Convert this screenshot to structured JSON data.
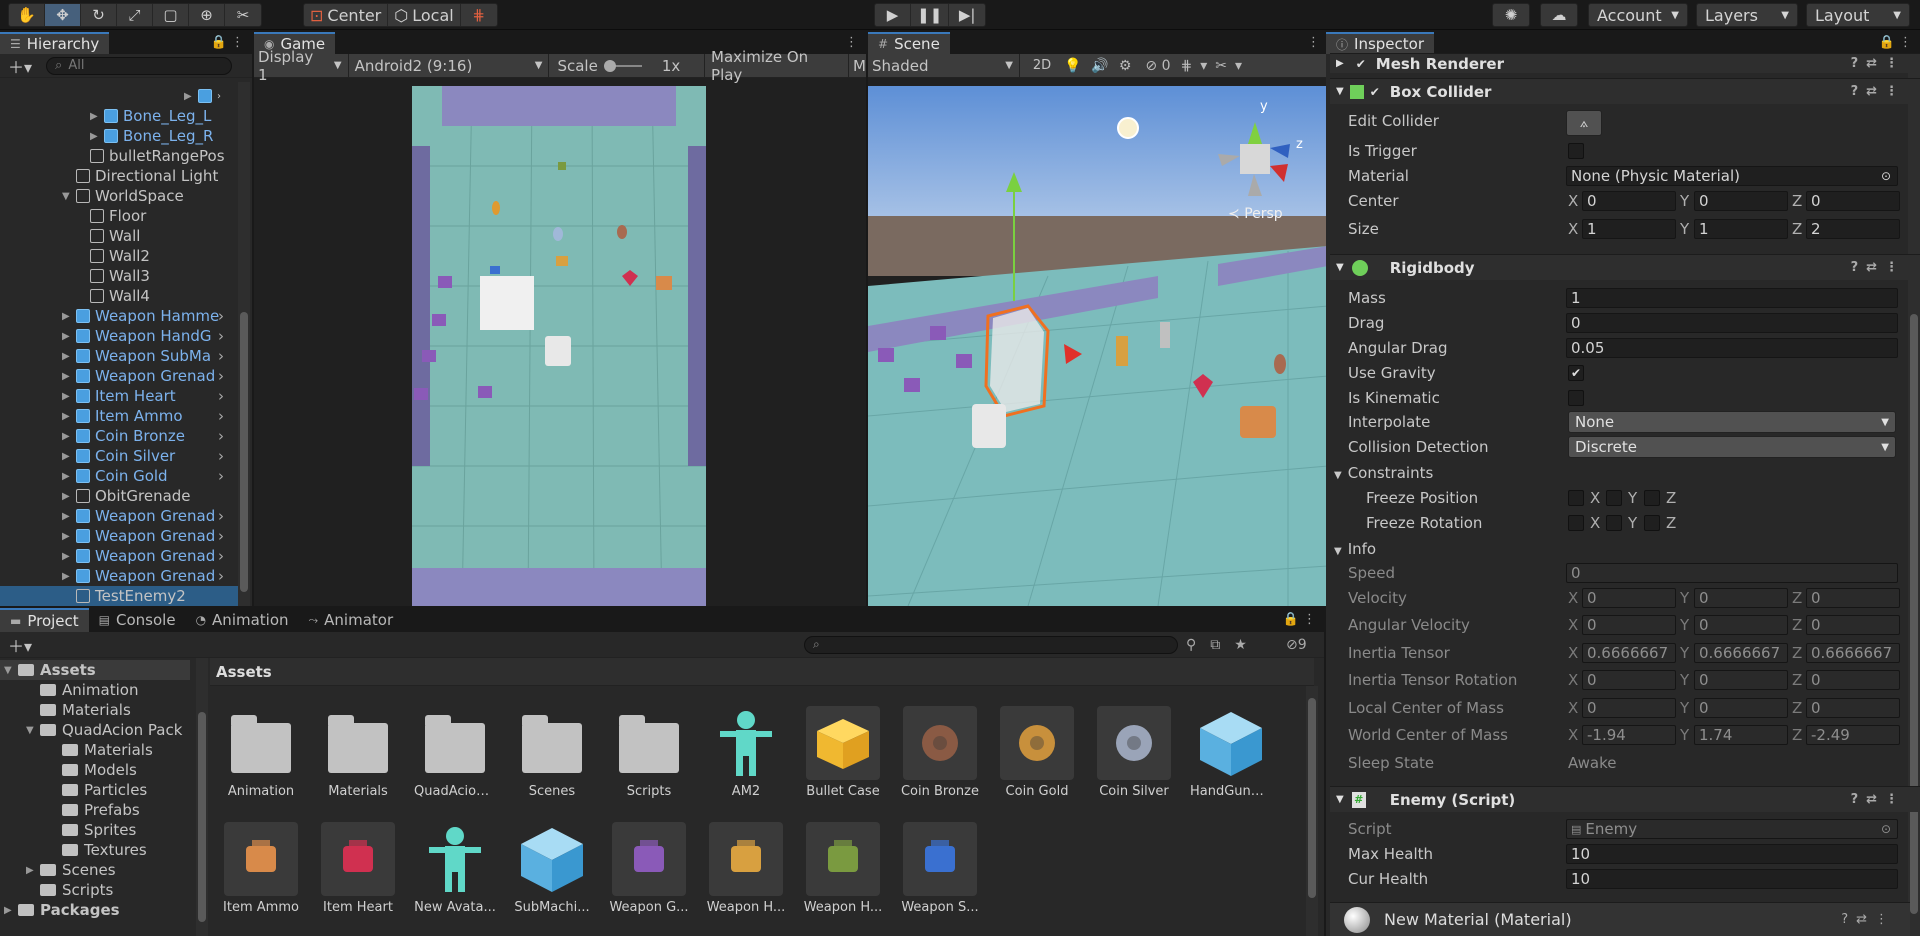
{
  "toolbar": {
    "pivot_center": "Center",
    "pivot_local": "Local",
    "account": "Account",
    "layers": "Layers",
    "layout": "Layout"
  },
  "hierarchy": {
    "tab": "Hierarchy",
    "search_placeholder": "All",
    "items": [
      {
        "label": "Bone_Leg_L",
        "depth": 6,
        "prefab": true,
        "expandable": true
      },
      {
        "label": "Bone_Leg_R",
        "depth": 6,
        "prefab": true,
        "expandable": true
      },
      {
        "label": "bulletRangePos",
        "depth": 5,
        "prefab": false,
        "expandable": false
      },
      {
        "label": "Directional Light",
        "depth": 4,
        "prefab": false,
        "expandable": false
      },
      {
        "label": "WorldSpace",
        "depth": 4,
        "prefab": false,
        "expandable": true
      },
      {
        "label": "Floor",
        "depth": 5,
        "prefab": false,
        "expandable": false
      },
      {
        "label": "Wall",
        "depth": 5,
        "prefab": false,
        "expandable": false
      },
      {
        "label": "Wall2",
        "depth": 5,
        "prefab": false,
        "expandable": false
      },
      {
        "label": "Wall3",
        "depth": 5,
        "prefab": false,
        "expandable": false
      },
      {
        "label": "Wall4",
        "depth": 5,
        "prefab": false,
        "expandable": false
      },
      {
        "label": "Weapon Hamme",
        "depth": 4,
        "prefab": true,
        "expandable": true
      },
      {
        "label": "Weapon HandG",
        "depth": 4,
        "prefab": true,
        "expandable": true
      },
      {
        "label": "Weapon SubMa",
        "depth": 4,
        "prefab": true,
        "expandable": true
      },
      {
        "label": "Weapon Grenad",
        "depth": 4,
        "prefab": true,
        "expandable": true
      },
      {
        "label": "Item Heart",
        "depth": 4,
        "prefab": true,
        "expandable": true
      },
      {
        "label": "Item Ammo",
        "depth": 4,
        "prefab": true,
        "expandable": true
      },
      {
        "label": "Coin Bronze",
        "depth": 4,
        "prefab": true,
        "expandable": true
      },
      {
        "label": "Coin Silver",
        "depth": 4,
        "prefab": true,
        "expandable": true
      },
      {
        "label": "Coin Gold",
        "depth": 4,
        "prefab": true,
        "expandable": true
      },
      {
        "label": "ObitGrenade",
        "depth": 4,
        "prefab": false,
        "expandable": true
      },
      {
        "label": "Weapon Grenad",
        "depth": 4,
        "prefab": true,
        "expandable": true
      },
      {
        "label": "Weapon Grenad",
        "depth": 4,
        "prefab": true,
        "expandable": true
      },
      {
        "label": "Weapon Grenad",
        "depth": 4,
        "prefab": true,
        "expandable": true
      },
      {
        "label": "Weapon Grenad",
        "depth": 4,
        "prefab": true,
        "expandable": true
      },
      {
        "label": "TestEnemy2",
        "depth": 4,
        "prefab": false,
        "expandable": false,
        "selected": true
      }
    ]
  },
  "game": {
    "tab": "Game",
    "display": "Display 1",
    "resolution": "Android2 (9:16)",
    "scale_label": "Scale",
    "scale_value": "1x",
    "maximize": "Maximize On Play",
    "extra": "M"
  },
  "scene": {
    "tab": "Scene",
    "shading": "Shaded",
    "mode_2d": "2D",
    "hidden_count": "0",
    "persp": "Persp",
    "gizmo_y": "y",
    "gizmo_z": "z"
  },
  "inspector": {
    "tab": "Inspector",
    "mesh_renderer": "Mesh Renderer",
    "box_collider": {
      "title": "Box Collider",
      "edit_collider": "Edit Collider",
      "is_trigger": "Is Trigger",
      "material_label": "Material",
      "material_value": "None (Physic Material)",
      "center_label": "Center",
      "center": [
        "0",
        "0",
        "0"
      ],
      "size_label": "Size",
      "size": [
        "1",
        "1",
        "2"
      ]
    },
    "rigidbody": {
      "title": "Rigidbody",
      "mass_label": "Mass",
      "mass": "1",
      "drag_label": "Drag",
      "drag": "0",
      "angular_drag_label": "Angular Drag",
      "angular_drag": "0.05",
      "use_gravity_label": "Use Gravity",
      "is_kinematic_label": "Is Kinematic",
      "interpolate_label": "Interpolate",
      "interpolate": "None",
      "collision_label": "Collision Detection",
      "collision": "Discrete",
      "constraints": "Constraints",
      "freeze_position": "Freeze Position",
      "freeze_rotation": "Freeze Rotation",
      "info": "Info",
      "speed_label": "Speed",
      "speed": "0",
      "velocity_label": "Velocity",
      "velocity": [
        "0",
        "0",
        "0"
      ],
      "ang_velocity_label": "Angular Velocity",
      "ang_velocity": [
        "0",
        "0",
        "0"
      ],
      "inertia_label": "Inertia Tensor",
      "inertia": [
        "0.6666667",
        "0.6666667",
        "0.6666667"
      ],
      "inertia_rot_label": "Inertia Tensor Rotation",
      "inertia_rot": [
        "0",
        "0",
        "0"
      ],
      "local_com_label": "Local Center of Mass",
      "local_com": [
        "0",
        "0",
        "0"
      ],
      "world_com_label": "World Center of Mass",
      "world_com": [
        "-1.94",
        "1.74",
        "-2.49"
      ],
      "sleep_label": "Sleep State",
      "sleep": "Awake"
    },
    "enemy": {
      "title": "Enemy (Script)",
      "script_label": "Script",
      "script": "Enemy",
      "max_health_label": "Max Health",
      "max_health": "10",
      "cur_health_label": "Cur Health",
      "cur_health": "10"
    },
    "material_footer": "New Material (Material)",
    "xyz": [
      "X",
      "Y",
      "Z"
    ]
  },
  "bottom": {
    "tabs": [
      "Project",
      "Console",
      "Animation",
      "Animator"
    ],
    "hidden_count": "9",
    "tree": [
      {
        "label": "Assets",
        "depth": 0,
        "bold": true
      },
      {
        "label": "Animation",
        "depth": 1
      },
      {
        "label": "Materials",
        "depth": 1
      },
      {
        "label": "QuadAcion Pack",
        "depth": 1
      },
      {
        "label": "Materials",
        "depth": 2
      },
      {
        "label": "Models",
        "depth": 2
      },
      {
        "label": "Particles",
        "depth": 2
      },
      {
        "label": "Prefabs",
        "depth": 2
      },
      {
        "label": "Sprites",
        "depth": 2
      },
      {
        "label": "Textures",
        "depth": 2
      },
      {
        "label": "Scenes",
        "depth": 1
      },
      {
        "label": "Scripts",
        "depth": 1
      },
      {
        "label": "Packages",
        "depth": 0,
        "bold": true
      }
    ],
    "breadcrumb": "Assets",
    "assets": [
      {
        "label": "Animation",
        "kind": "folder"
      },
      {
        "label": "Materials",
        "kind": "folder"
      },
      {
        "label": "QuadAcion...",
        "kind": "folder"
      },
      {
        "label": "Scenes",
        "kind": "folder"
      },
      {
        "label": "Scripts",
        "kind": "folder"
      },
      {
        "label": "AM2",
        "kind": "avatar"
      },
      {
        "label": "Bullet Case",
        "kind": "box"
      },
      {
        "label": "Coin Bronze",
        "kind": "coin",
        "color": "#8a5a44"
      },
      {
        "label": "Coin Gold",
        "kind": "coin",
        "color": "#c8903c"
      },
      {
        "label": "Coin Silver",
        "kind": "coin",
        "color": "#9aa4b8"
      },
      {
        "label": "HandGunB...",
        "kind": "cube"
      },
      {
        "label": "Item Ammo",
        "kind": "item",
        "color": "#d88a4a"
      },
      {
        "label": "Item Heart",
        "kind": "item",
        "color": "#d03050"
      },
      {
        "label": "New Avata...",
        "kind": "avatar"
      },
      {
        "label": "SubMachi...",
        "kind": "cube"
      },
      {
        "label": "Weapon G...",
        "kind": "item",
        "color": "#8a5ab8"
      },
      {
        "label": "Weapon H...",
        "kind": "item",
        "color": "#d8a040"
      },
      {
        "label": "Weapon H...",
        "kind": "item",
        "color": "#7a9a40"
      },
      {
        "label": "Weapon S...",
        "kind": "item",
        "color": "#3a70d0"
      }
    ]
  }
}
